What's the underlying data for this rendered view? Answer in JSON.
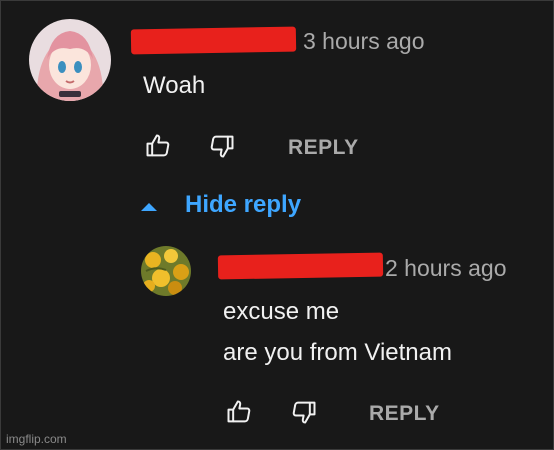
{
  "comment": {
    "timestamp": "3 hours ago",
    "text": "Woah",
    "reply_label": "REPLY",
    "avatar_icon": "anime-girl-avatar-icon"
  },
  "toggle": {
    "label": "Hide reply",
    "icon": "caret-up-icon"
  },
  "reply": {
    "timestamp": "2 hours ago",
    "lines": [
      "excuse me",
      "are you from Vietnam"
    ],
    "reply_label": "REPLY",
    "avatar_icon": "yellow-flowers-avatar-icon"
  },
  "watermark": "imgflip.com",
  "colors": {
    "background": "#181818",
    "redaction": "#e8211c",
    "link_blue": "#3ea6ff",
    "muted": "#aaaaaa",
    "text": "#f1f1f1"
  }
}
